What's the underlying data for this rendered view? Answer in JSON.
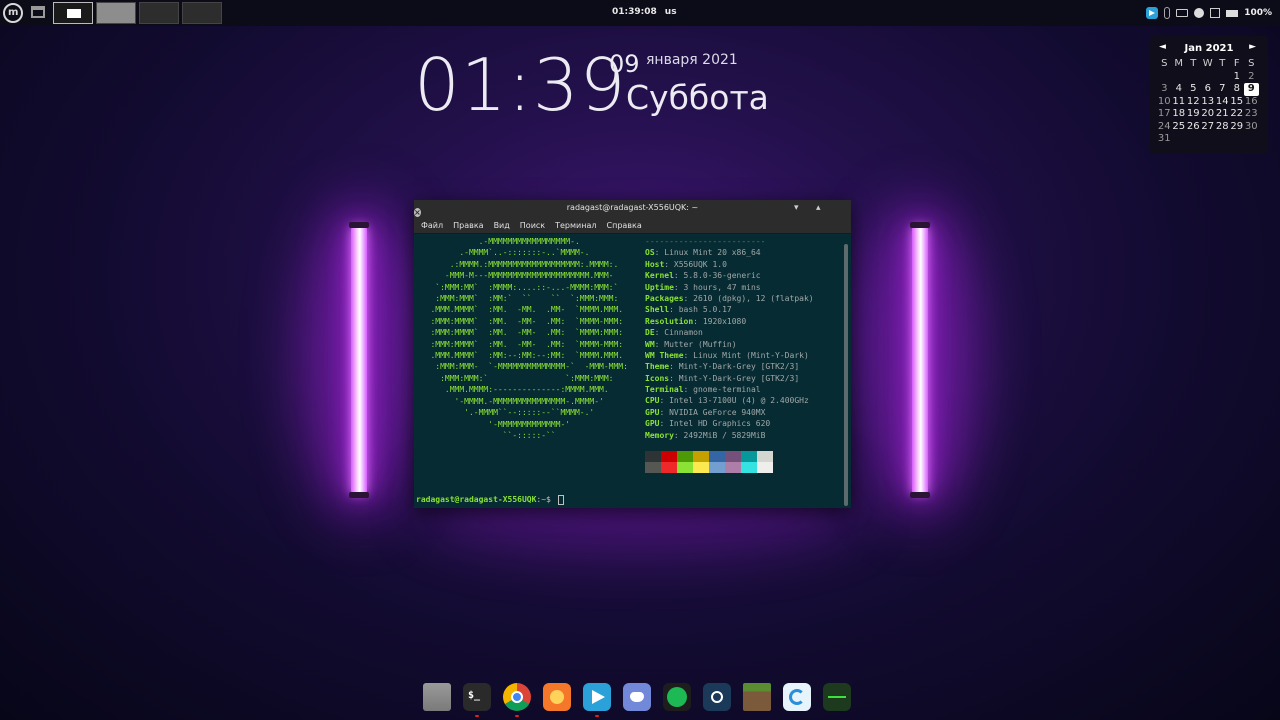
{
  "panel": {
    "clock": "01:39:08",
    "keyboard_layout": "us",
    "battery": "100%"
  },
  "desktop_clock": {
    "time": "01:39",
    "day": "09",
    "month_year": "января 2021",
    "weekday": "Суббота"
  },
  "calendar": {
    "month": "Jan 2021",
    "prev": "◄",
    "next": "►",
    "weekdays": [
      "S",
      "M",
      "T",
      "W",
      "T",
      "F",
      "S"
    ],
    "weeks": [
      [
        "",
        "",
        "",
        "",
        "",
        "1",
        "2"
      ],
      [
        "3",
        "4",
        "5",
        "6",
        "7",
        "8",
        "9"
      ],
      [
        "10",
        "11",
        "12",
        "13",
        "14",
        "15",
        "16"
      ],
      [
        "17",
        "18",
        "19",
        "20",
        "21",
        "22",
        "23"
      ],
      [
        "24",
        "25",
        "26",
        "27",
        "28",
        "29",
        "30"
      ],
      [
        "31",
        "",
        "",
        "",
        "",
        "",
        ""
      ]
    ],
    "today": "9"
  },
  "terminal": {
    "title": "radagast@radagast-X556UQK: ~",
    "menu": [
      "Файл",
      "Правка",
      "Вид",
      "Поиск",
      "Терминал",
      "Справка"
    ],
    "ascii": "             .-MMMMMMMMMMMMMMMMM-.\n         .-MMMM`..-:::::::-..`MMMM-.\n       .:MMMM.:MMMMMMMMMMMMMMMMMMM:.MMMM:.\n      -MMM-M---MMMMMMMMMMMMMMMMMMMMM.MMM-\n    `:MMM:MM`  :MMMM:....::-...-MMMM:MMM:`\n    :MMM:MMM`  :MM:`  ``    ``  `:MMM:MMM:\n   .MMM.MMMM`  :MM.  -MM.  .MM-  `MMMM.MMM.\n   :MMM:MMMM`  :MM.  -MM-  .MM:  `MMMM-MMM:\n   :MMM:MMMM`  :MM.  -MM-  .MM:  `MMMM:MMM:\n   :MMM:MMMM`  :MM.  -MM-  .MM:  `MMMM-MMM:\n   .MMM.MMMM`  :MM:--:MM:--:MM:  `MMMM.MMM.\n    :MMM:MMM-  `-MMMMMMMMMMMMMM-`  -MMM-MMM:\n     :MMM:MMM:`                `:MMM:MMM:\n      .MMM.MMMM:--------------:MMMM.MMM.\n        '-MMMM.-MMMMMMMMMMMMMMM-.MMMM-'\n          '.-MMMM``--:::::--``MMMM-.'\n               '-MMMMMMMMMMMMM-'\n                  ``-:::::-``",
    "separator": "-------------------------",
    "info": [
      {
        "key": "OS",
        "value": "Linux Mint 20 x86_64"
      },
      {
        "key": "Host",
        "value": "X556UQK 1.0"
      },
      {
        "key": "Kernel",
        "value": "5.8.0-36-generic"
      },
      {
        "key": "Uptime",
        "value": "3 hours, 47 mins"
      },
      {
        "key": "Packages",
        "value": "2610 (dpkg), 12 (flatpak)"
      },
      {
        "key": "Shell",
        "value": "bash 5.0.17"
      },
      {
        "key": "Resolution",
        "value": "1920x1080"
      },
      {
        "key": "DE",
        "value": "Cinnamon"
      },
      {
        "key": "WM",
        "value": "Mutter (Muffin)"
      },
      {
        "key": "WM Theme",
        "value": "Linux Mint (Mint-Y-Dark)"
      },
      {
        "key": "Theme",
        "value": "Mint-Y-Dark-Grey [GTK2/3]"
      },
      {
        "key": "Icons",
        "value": "Mint-Y-Dark-Grey [GTK2/3]"
      },
      {
        "key": "Terminal",
        "value": "gnome-terminal"
      },
      {
        "key": "CPU",
        "value": "Intel i3-7100U (4) @ 2.400GHz"
      },
      {
        "key": "GPU",
        "value": "NVIDIA GeForce 940MX"
      },
      {
        "key": "GPU",
        "value": "Intel HD Graphics 620"
      },
      {
        "key": "Memory",
        "value": "2492MiB / 5829MiB"
      }
    ],
    "palette": [
      "#2e3436",
      "#cc0000",
      "#4e9a06",
      "#c4a000",
      "#3465a4",
      "#75507b",
      "#06989a",
      "#d3d7cf",
      "#555753",
      "#ef2929",
      "#8ae234",
      "#fce94f",
      "#729fcf",
      "#ad7fa8",
      "#34e2e2",
      "#eeeeec"
    ],
    "prompt_user": "radagast@radagast-X556UQK",
    "prompt_path": ":~$ "
  },
  "dock": [
    {
      "name": "folder",
      "running": false
    },
    {
      "name": "terminal",
      "running": true
    },
    {
      "name": "chrome",
      "running": true
    },
    {
      "name": "firefox",
      "running": false
    },
    {
      "name": "telegram",
      "running": true
    },
    {
      "name": "discord",
      "running": false
    },
    {
      "name": "spotify",
      "running": false
    },
    {
      "name": "steam",
      "running": false
    },
    {
      "name": "minecraft",
      "running": false
    },
    {
      "name": "edge",
      "running": false
    },
    {
      "name": "monitor",
      "running": false
    }
  ]
}
